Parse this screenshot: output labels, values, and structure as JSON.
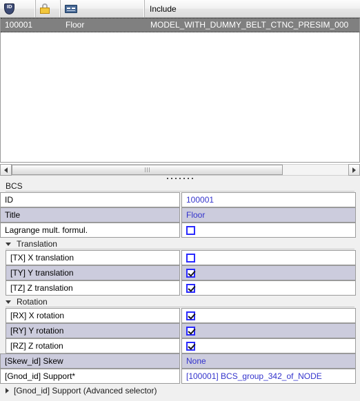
{
  "list": {
    "columns": [
      {
        "key": "id",
        "icon": "id-shield-icon",
        "label": ""
      },
      {
        "key": "lock",
        "icon": "padlock-icon",
        "label": ""
      },
      {
        "key": "card",
        "icon": "label-card-icon",
        "label": ""
      },
      {
        "key": "include",
        "icon": "",
        "label": "Include"
      }
    ],
    "rows": [
      {
        "id": "100001",
        "lock": "",
        "card": "Floor",
        "include": "MODEL_WITH_DUMMY_BELT_CTNC_PRESIM_000",
        "selected": true
      }
    ],
    "scrollbar": {
      "left_arrow": "◄",
      "right_arrow": "►"
    }
  },
  "properties": {
    "group_title": "BCS",
    "rows": [
      {
        "name": "ID",
        "value": "100001",
        "type": "text",
        "alt": false,
        "indent": false
      },
      {
        "name": "Title",
        "value": "Floor",
        "type": "text",
        "alt": true,
        "indent": false
      },
      {
        "name": "Lagrange mult. formul.",
        "value": "",
        "type": "checkbox",
        "checked": false,
        "alt": false,
        "indent": false
      }
    ],
    "sections": [
      {
        "title": "Translation",
        "expanded": true,
        "rows": [
          {
            "name": "[TX] X translation",
            "type": "checkbox",
            "checked": false,
            "alt": false
          },
          {
            "name": "[TY] Y translation",
            "type": "checkbox",
            "checked": true,
            "alt": true
          },
          {
            "name": "[TZ] Z translation",
            "type": "checkbox",
            "checked": true,
            "alt": false
          }
        ]
      },
      {
        "title": "Rotation",
        "expanded": true,
        "rows": [
          {
            "name": "[RX] X rotation",
            "type": "checkbox",
            "checked": true,
            "alt": false
          },
          {
            "name": "[RY] Y rotation",
            "type": "checkbox",
            "checked": true,
            "alt": true
          },
          {
            "name": "[RZ] Z rotation",
            "type": "checkbox",
            "checked": true,
            "alt": false
          }
        ]
      }
    ],
    "tail_rows": [
      {
        "name": "[Skew_id] Skew",
        "value": "None",
        "type": "text",
        "alt": true,
        "indent": false
      },
      {
        "name": "[Gnod_id] Support*",
        "value": "[100001] BCS_group_342_of_NODE",
        "type": "text",
        "alt": false,
        "indent": false
      }
    ],
    "footer": {
      "label": "[Gnod_id] Support (Advanced selector)",
      "expanded": false
    }
  },
  "colors": {
    "selection_bg": "#808080",
    "value_text": "#3333cc",
    "alt_row_bg": "#ccccdd",
    "panel_bg": "#f0f0f0",
    "checkbox_border": "#2a2aff"
  }
}
